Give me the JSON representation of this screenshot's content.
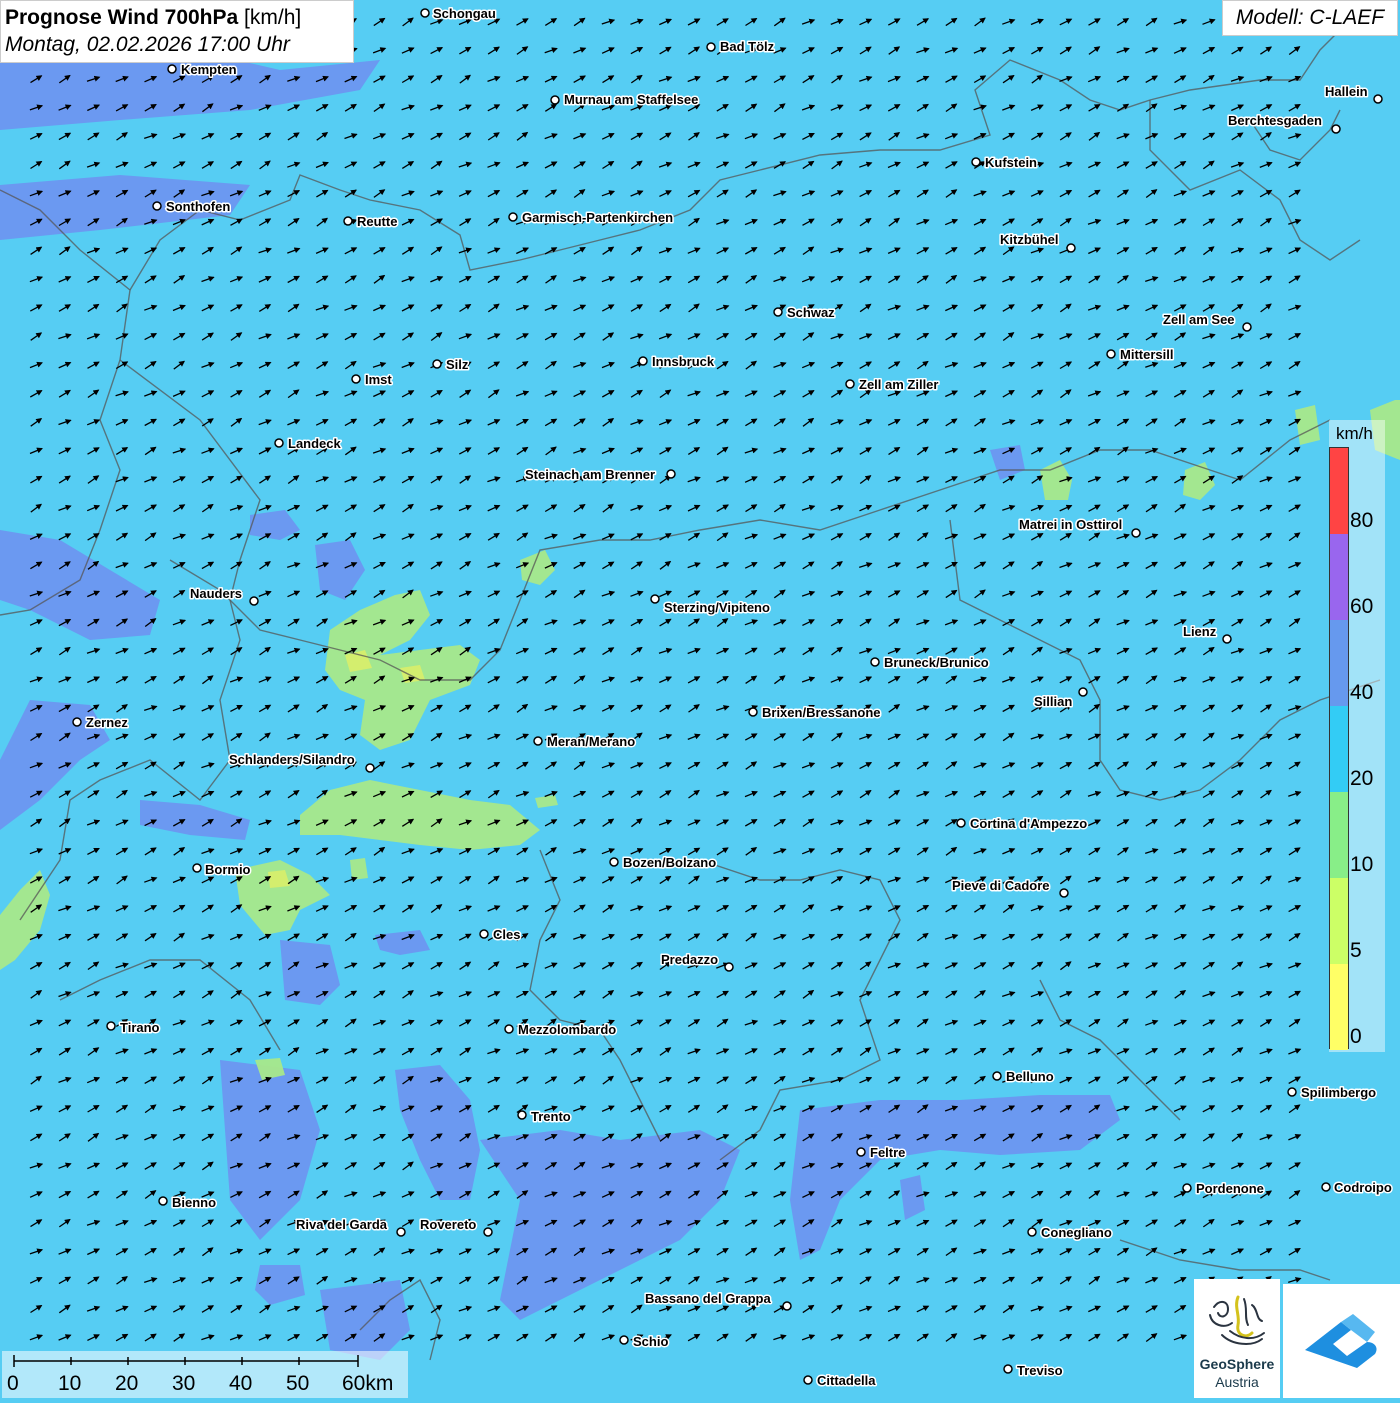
{
  "header": {
    "title_bold": "Prognose Wind 700hPa",
    "title_unit": "[km/h]",
    "datetime": "Montag, 02.02.2026 17:00 Uhr",
    "model": "Modell: C-LAEF"
  },
  "legend": {
    "unit": "km/h",
    "colors": [
      "#ffff66",
      "#ccff66",
      "#88ee88",
      "#33ccf5",
      "#6699ee",
      "#9966ee",
      "#ff4444"
    ],
    "ticks": [
      "0",
      "5",
      "10",
      "20",
      "40",
      "60",
      "80"
    ]
  },
  "scale": {
    "labels": [
      "0",
      "10",
      "20",
      "30",
      "40",
      "50",
      "60km"
    ]
  },
  "logo": {
    "line1": "GeoSphere",
    "line2": "Austria"
  },
  "colors": {
    "base_wind": "#56cdf3",
    "strong_wind": "#6f8ff0",
    "weak_wind": "#a8e88a"
  },
  "cities": [
    {
      "name": "Schongau"
    },
    {
      "name": "Bad Tölz"
    },
    {
      "name": "Kempten"
    },
    {
      "name": "Murnau am Staffelsee"
    },
    {
      "name": "Hallein"
    },
    {
      "name": "Berchtesgaden"
    },
    {
      "name": "Kufstein"
    },
    {
      "name": "Sonthofen"
    },
    {
      "name": "Reutte"
    },
    {
      "name": "Garmisch-Partenkirchen"
    },
    {
      "name": "Kitzbühel"
    },
    {
      "name": "Schwaz"
    },
    {
      "name": "Zell am See"
    },
    {
      "name": "Mittersill"
    },
    {
      "name": "Innsbruck"
    },
    {
      "name": "Silz"
    },
    {
      "name": "Imst"
    },
    {
      "name": "Zell am Ziller"
    },
    {
      "name": "Landeck"
    },
    {
      "name": "Steinach am Brenner"
    },
    {
      "name": "Matrei in Osttirol"
    },
    {
      "name": "Nauders"
    },
    {
      "name": "Sterzing/Vipiteno"
    },
    {
      "name": "Lienz"
    },
    {
      "name": "Bruneck/Brunico"
    },
    {
      "name": "Sillian"
    },
    {
      "name": "Brixen/Bressanone"
    },
    {
      "name": "Zernez"
    },
    {
      "name": "Meran/Merano"
    },
    {
      "name": "Schlanders/Silandro"
    },
    {
      "name": "Cortina d'Ampezzo"
    },
    {
      "name": "Bozen/Bolzano"
    },
    {
      "name": "Bormio"
    },
    {
      "name": "Pieve di Cadore"
    },
    {
      "name": "Cles"
    },
    {
      "name": "Predazzo"
    },
    {
      "name": "Tirano"
    },
    {
      "name": "Mezzolombardo"
    },
    {
      "name": "Belluno"
    },
    {
      "name": "Spilimbergo"
    },
    {
      "name": "Trento"
    },
    {
      "name": "Feltre"
    },
    {
      "name": "Pordenone"
    },
    {
      "name": "Codroipo"
    },
    {
      "name": "Bienno"
    },
    {
      "name": "Riva del Garda"
    },
    {
      "name": "Rovereto"
    },
    {
      "name": "Conegliano"
    },
    {
      "name": "Bassano del Grappa"
    },
    {
      "name": "Schio"
    },
    {
      "name": "Treviso"
    },
    {
      "name": "Cittadella"
    }
  ]
}
